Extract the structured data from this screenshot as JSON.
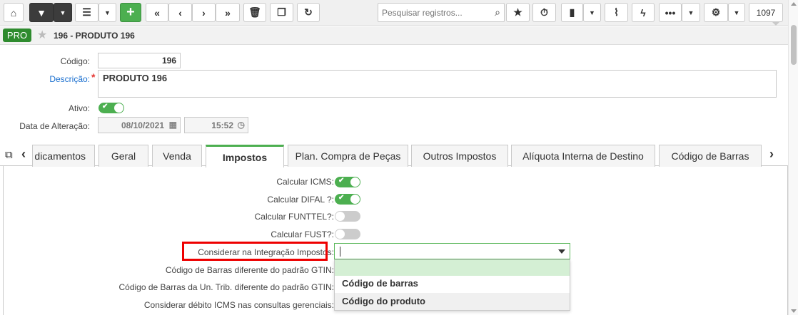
{
  "toolbar": {
    "search_placeholder": "Pesquisar registros...",
    "record_count": "1097"
  },
  "record": {
    "badge": "PRO",
    "title": "196 - PRODUTO 196"
  },
  "form": {
    "codigo_label": "Código:",
    "codigo_value": "196",
    "descricao_label": "Descrição:",
    "descricao_value": "PRODUTO 196",
    "ativo_label": "Ativo:",
    "ativo_value": true,
    "data_alteracao_label": "Data de Alteração:",
    "data_value": "08/10/2021",
    "hora_value": "15:52"
  },
  "tabs": [
    {
      "label": "dicamentos",
      "active": false
    },
    {
      "label": "Geral",
      "active": false
    },
    {
      "label": "Venda",
      "active": false
    },
    {
      "label": "Impostos",
      "active": true
    },
    {
      "label": "Plan. Compra de Peças",
      "active": false
    },
    {
      "label": "Outros Impostos",
      "active": false
    },
    {
      "label": "Alíquota Interna de Destino",
      "active": false
    },
    {
      "label": "Código de Barras",
      "active": false
    }
  ],
  "impostos": {
    "fields": [
      {
        "label": "Calcular ICMS:",
        "type": "toggle",
        "value": true
      },
      {
        "label": "Calcular DIFAL ?:",
        "type": "toggle",
        "value": true
      },
      {
        "label": "Calcular FUNTTEL?:",
        "type": "toggle",
        "value": false
      },
      {
        "label": "Calcular FUST?:",
        "type": "toggle",
        "value": false
      },
      {
        "label": "Considerar na Integração Impostos:",
        "type": "select",
        "value": ""
      },
      {
        "label": "Código de Barras diferente do padrão GTIN:",
        "type": "hidden"
      },
      {
        "label": "Código de Barras da Un. Trib. diferente do padrão GTIN:",
        "type": "hidden"
      },
      {
        "label": "Considerar débito ICMS nas consultas gerenciais:",
        "type": "hidden"
      }
    ],
    "dropdown_options": [
      "",
      "Código de barras",
      "Código do produto"
    ]
  },
  "colors": {
    "accent": "#4caf50",
    "highlight_box": "#e00000",
    "badge": "#2e8b2e"
  }
}
